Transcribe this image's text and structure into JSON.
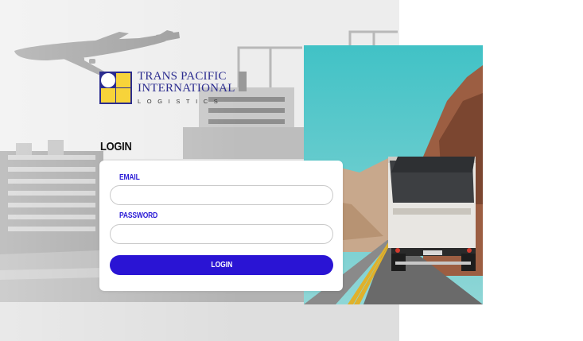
{
  "brand": {
    "line1": "TRANS PACIFIC",
    "line2": "INTERNATIONAL",
    "line3": "LOGISTICS"
  },
  "login": {
    "heading": "LOGIN",
    "email_label": "EMAIL",
    "email_value": "",
    "password_label": "PASSWORD",
    "password_value": "",
    "button_label": "LOGIN"
  },
  "colors": {
    "brand_navy": "#2b2c8f",
    "brand_yellow": "#f7d33a",
    "accent_blue": "#2a14d4",
    "label_blue": "#2a1bd6"
  }
}
